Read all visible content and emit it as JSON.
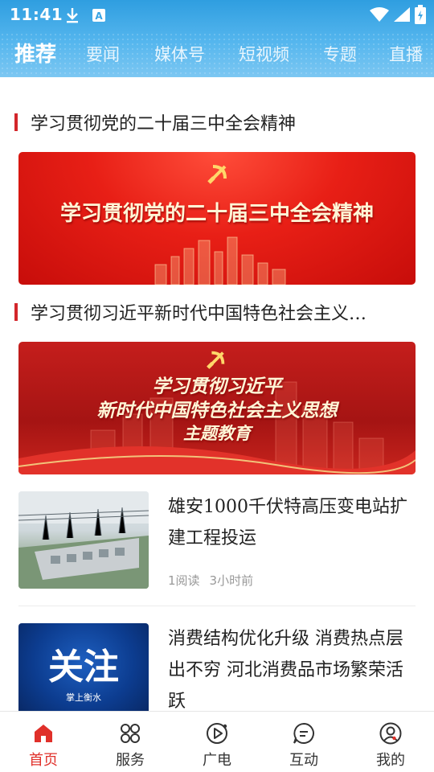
{
  "status_bar": {
    "time": "11:41",
    "icons": [
      "download-icon",
      "a-badge-icon",
      "wifi-icon",
      "signal-icon",
      "battery-icon"
    ]
  },
  "tabs": [
    {
      "label": "推荐",
      "active": true
    },
    {
      "label": "要闻",
      "active": false
    },
    {
      "label": "媒体号",
      "active": false
    },
    {
      "label": "短视频",
      "active": false
    },
    {
      "label": "专题",
      "active": false
    },
    {
      "label": "直播",
      "active": false
    }
  ],
  "sections": [
    {
      "title": "学习贯彻党的二十届三中全会精神",
      "banner_text": "学习贯彻党的二十届三中全会精神"
    },
    {
      "title": "学习贯彻习近平新时代中国特色社会主义…",
      "banner_lines": [
        "学习贯彻习近平",
        "新时代中国特色社会主义思想",
        "主题教育"
      ]
    }
  ],
  "news": [
    {
      "title": "雄安1000千伏特高压变电站扩建工程投运",
      "reads": "1阅读",
      "time": "3小时前"
    },
    {
      "title": "消费结构优化升级 消费热点层出不穷 河北消费品市场繁荣活跃",
      "thumb_text": "关注",
      "thumb_sub": "掌上衡水"
    }
  ],
  "bottom_nav": [
    {
      "label": "首页",
      "icon": "home-icon",
      "active": true
    },
    {
      "label": "服务",
      "icon": "grid-icon",
      "active": false
    },
    {
      "label": "广电",
      "icon": "play-icon",
      "active": false
    },
    {
      "label": "互动",
      "icon": "chat-icon",
      "active": false
    },
    {
      "label": "我的",
      "icon": "profile-icon",
      "active": false
    }
  ],
  "colors": {
    "accent_red": "#e0302a",
    "header_blue": "#3aa4e4",
    "banner_red": "#d9241c"
  }
}
